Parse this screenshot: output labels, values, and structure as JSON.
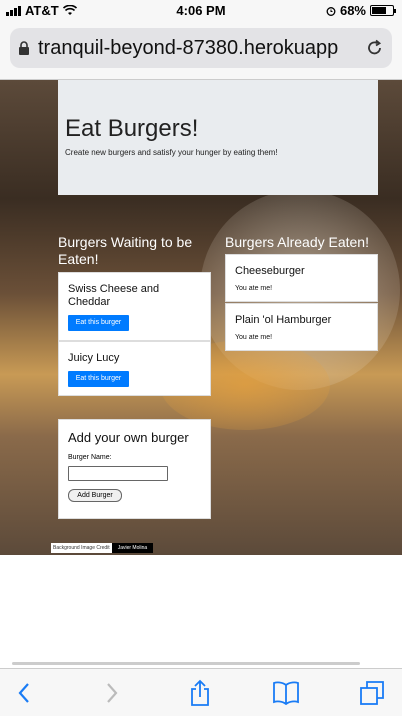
{
  "status_bar": {
    "carrier": "AT&T",
    "time": "4:06 PM",
    "battery": "68%",
    "battery_level": 0.68
  },
  "browser": {
    "url": "tranquil-beyond-87380.herokuapp"
  },
  "jumbotron": {
    "title": "Eat Burgers!",
    "subtitle": "Create new burgers and satisfy your hunger by eating them!"
  },
  "waiting": {
    "title": "Burgers Waiting to be Eaten!",
    "items": [
      {
        "name": "Swiss Cheese and Cheddar",
        "button": "Eat this burger"
      },
      {
        "name": "Juicy Lucy",
        "button": "Eat this burger"
      }
    ]
  },
  "eaten": {
    "title": "Burgers Already Eaten!",
    "items": [
      {
        "name": "Cheeseburger",
        "note": "You ate me!"
      },
      {
        "name": "Plain 'ol Hamburger",
        "note": "You ate me!"
      }
    ]
  },
  "form": {
    "title": "Add your own burger",
    "label": "Burger Name:",
    "value": "",
    "button": "Add Burger"
  },
  "credit": {
    "text": "Background Image Credit",
    "author": "Javier Molina"
  },
  "icons": {
    "back": "chevron-left-icon",
    "forward": "chevron-right-icon",
    "share": "share-icon",
    "bookmarks": "book-icon",
    "tabs": "tabs-icon",
    "reload": "reload-icon",
    "lock": "lock-icon"
  },
  "colors": {
    "primary_button": "#007bff",
    "jumbotron_bg": "#e9ecef"
  }
}
